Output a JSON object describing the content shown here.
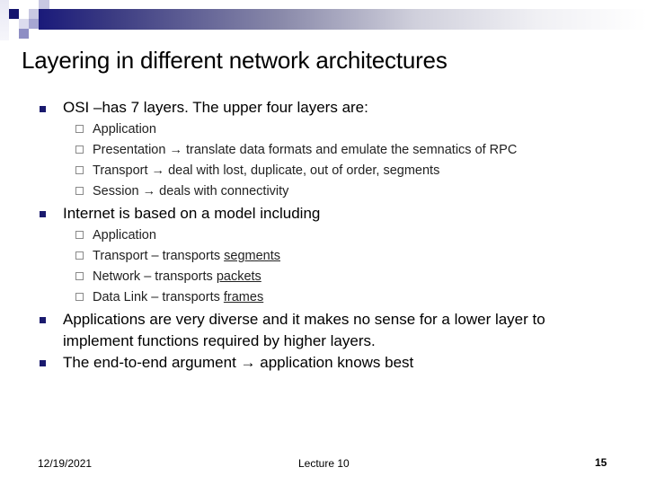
{
  "slide": {
    "title": "Layering in different network architectures",
    "bullets": [
      {
        "text": "OSI –has 7 layers. The upper four layers are:",
        "sub": [
          {
            "pre": "Application",
            "arrow": "",
            "post": "",
            "underlined": ""
          },
          {
            "pre": "Presentation ",
            "arrow": "→",
            "post": " translate data formats and emulate the semnatics of RPC",
            "underlined": ""
          },
          {
            "pre": "Transport ",
            "arrow": "→",
            "post": " deal with lost, duplicate, out of order, segments",
            "underlined": ""
          },
          {
            "pre": "Session ",
            "arrow": "→",
            "post": " deals with connectivity",
            "underlined": ""
          }
        ]
      },
      {
        "text": "Internet is based on a model including",
        "sub": [
          {
            "pre": "Application",
            "arrow": "",
            "post": "",
            "underlined": ""
          },
          {
            "pre": "Transport – transports ",
            "arrow": "",
            "post": "",
            "underlined": "segments"
          },
          {
            "pre": "Network – transports ",
            "arrow": "",
            "post": "",
            "underlined": "packets"
          },
          {
            "pre": "Data Link – transports ",
            "arrow": "",
            "post": "",
            "underlined": "frames"
          }
        ]
      },
      {
        "line1": "Applications are very diverse and it makes no sense for a lower layer to",
        "line2": "implement functions required by higher layers."
      },
      {
        "pre": "The end-to-end argument ",
        "arrow": "→",
        "post": " application knows best"
      }
    ]
  },
  "footer": {
    "date": "12/19/2021",
    "center": "Lecture 10",
    "page": "15"
  },
  "colors": {
    "bullet": "#1a1a6e",
    "bar_start": "#1a1a7a"
  }
}
